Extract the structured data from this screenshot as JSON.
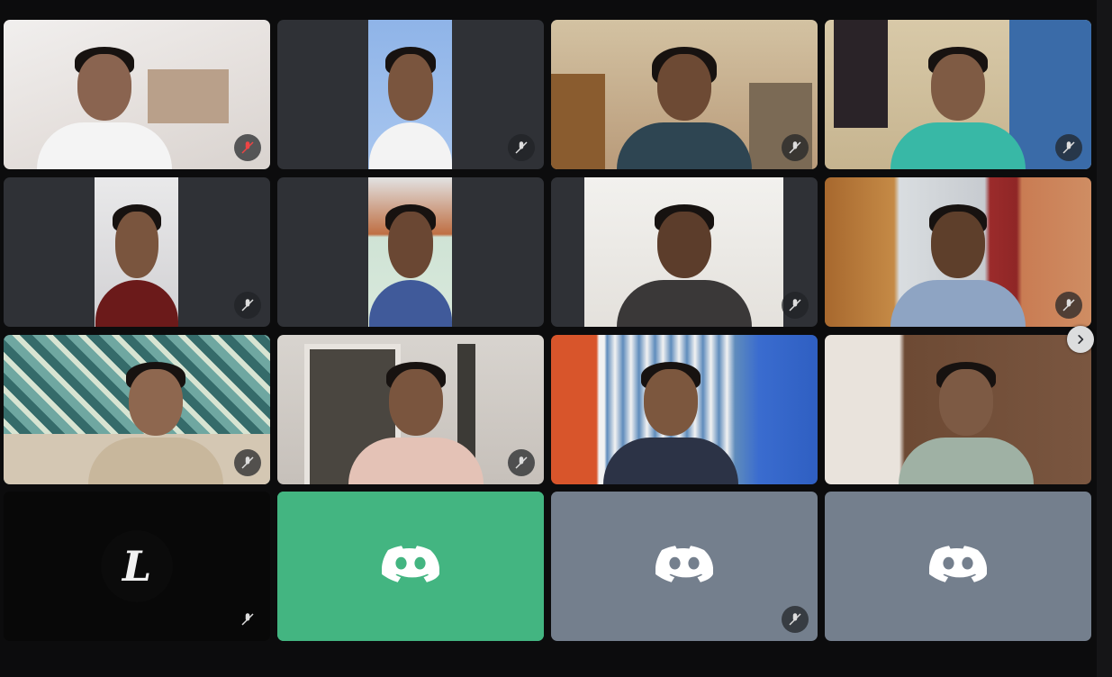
{
  "window": {
    "title": ""
  },
  "participants": [
    {
      "id": "p1",
      "kind": "video",
      "muted": true
    },
    {
      "id": "p2",
      "kind": "video",
      "muted": true
    },
    {
      "id": "p3",
      "kind": "video",
      "muted": true
    },
    {
      "id": "p4",
      "kind": "video",
      "muted": true
    },
    {
      "id": "p5",
      "kind": "video",
      "muted": true
    },
    {
      "id": "p6",
      "kind": "video",
      "muted": false
    },
    {
      "id": "p7",
      "kind": "video",
      "muted": true
    },
    {
      "id": "p8",
      "kind": "video",
      "muted": true
    },
    {
      "id": "p9",
      "kind": "video",
      "muted": true
    },
    {
      "id": "p10",
      "kind": "video",
      "muted": true
    },
    {
      "id": "p11",
      "kind": "video",
      "muted": false
    },
    {
      "id": "p12",
      "kind": "video",
      "muted": false
    },
    {
      "id": "p13",
      "kind": "avatar",
      "avatar_letter": "L",
      "muted": true
    },
    {
      "id": "p14",
      "kind": "avatar",
      "avatar_icon": "discord-logo-icon",
      "speaking": true,
      "muted": false
    },
    {
      "id": "p15",
      "kind": "avatar",
      "avatar_icon": "discord-logo-icon",
      "muted": true
    },
    {
      "id": "p16",
      "kind": "avatar",
      "avatar_icon": "discord-logo-icon",
      "muted": false
    }
  ],
  "navigation": {
    "next_page_icon": "chevron-right-icon"
  },
  "colors": {
    "app_background": "#0c0c0d",
    "tile_background": "#202225",
    "speaking_green": "#43b581",
    "avatar_gray": "#747f8d",
    "logo_white": "#ffffff"
  }
}
